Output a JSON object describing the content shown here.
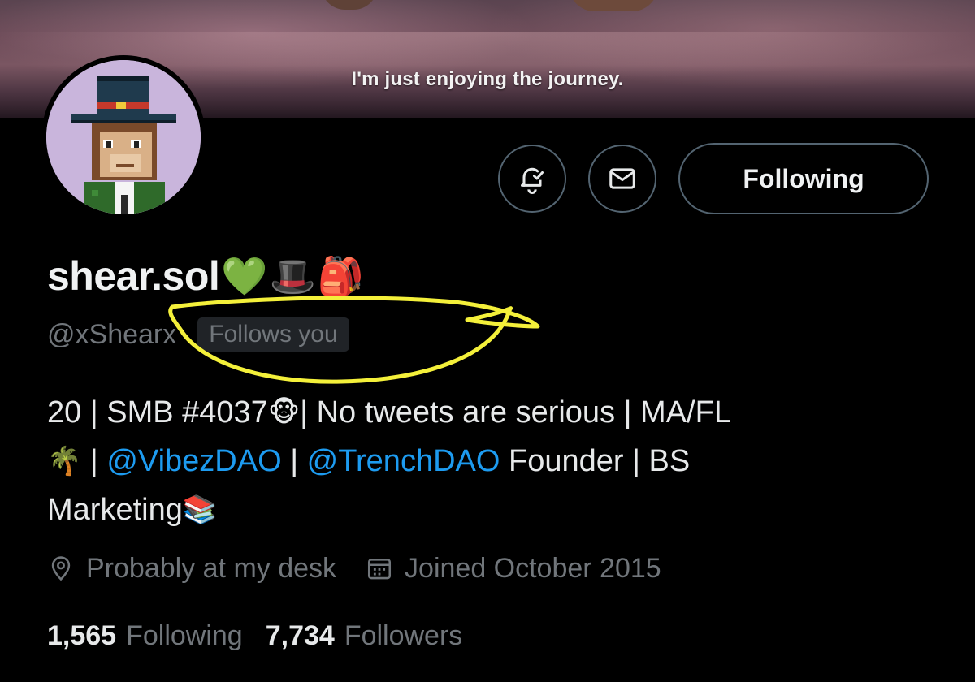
{
  "banner": {
    "caption": "I'm just enjoying the journey."
  },
  "actions": {
    "notify_icon": "bell-check-icon",
    "message_icon": "envelope-icon",
    "following_label": "Following"
  },
  "profile": {
    "display_name": "shear.sol",
    "name_emojis": [
      "💚",
      "🎩",
      "🎒"
    ],
    "handle": "@xShearx",
    "follows_you": "Follows you"
  },
  "bio": {
    "line1_a": "20 | SMB #4037",
    "line1_emoji": "🐵",
    "line1_b": " | No tweets are serious | MA/FL",
    "line2_emoji": "🌴",
    "line2_sep": " | ",
    "mention1": "@VibezDAO",
    "line2_sep2": " | ",
    "mention2": "@TrenchDAO",
    "line2_tail": " Founder | BS",
    "line3": "Marketing",
    "line3_emoji": "📚"
  },
  "meta": {
    "location": "Probably at my desk",
    "joined": "Joined October 2015"
  },
  "stats": {
    "following_count": "1,565",
    "following_label": "Following",
    "followers_count": "7,734",
    "followers_label": "Followers"
  },
  "colors": {
    "background": "#000000",
    "link": "#1d9bf0",
    "secondary_text": "#71767b",
    "highlight": "#f4f03a"
  }
}
